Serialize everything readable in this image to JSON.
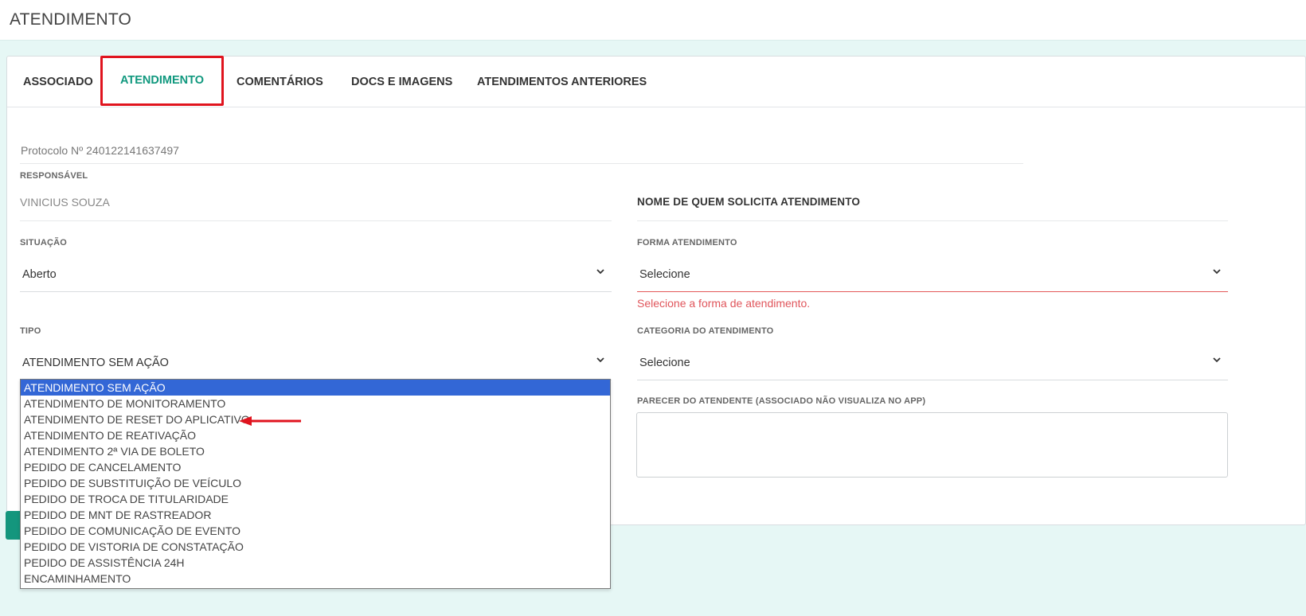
{
  "header": {
    "title": "ATENDIMENTO"
  },
  "tabs": [
    {
      "label": "ASSOCIADO"
    },
    {
      "label": "ATENDIMENTO"
    },
    {
      "label": "COMENTÁRIOS"
    },
    {
      "label": "DOCS E IMAGENS"
    },
    {
      "label": "ATENDIMENTOS ANTERIORES"
    }
  ],
  "active_tab": "ATENDIMENTO",
  "form": {
    "protocol": "Protocolo Nº 240122141637497",
    "responsavel_label": "RESPONSÁVEL",
    "responsavel_value": "VINICIUS SOUZA",
    "solicitante_label": "NOME DE QUEM SOLICITA ATENDIMENTO",
    "situacao_label": "SITUAÇÃO",
    "situacao_value": "Aberto",
    "forma_label": "FORMA ATENDIMENTO",
    "forma_value": "Selecione",
    "forma_error": "Selecione a forma de atendimento.",
    "tipo_label": "TIPO",
    "tipo_value": "ATENDIMENTO SEM AÇÃO",
    "categoria_label": "CATEGORIA DO ATENDIMENTO",
    "categoria_value": "Selecione",
    "parecer_label": "PARECER DO ATENDENTE (ASSOCIADO NÃO VISUALIZA NO APP)",
    "parecer_value": ""
  },
  "tipo_options": [
    "ATENDIMENTO SEM AÇÃO",
    "ATENDIMENTO DE MONITORAMENTO",
    "ATENDIMENTO DE RESET DO APLICATIVO",
    "ATENDIMENTO DE REATIVAÇÃO",
    "ATENDIMENTO 2ª VIA DE BOLETO",
    "PEDIDO DE CANCELAMENTO",
    "PEDIDO DE SUBSTITUIÇÃO DE VEÍCULO",
    "PEDIDO DE TROCA DE TITULARIDADE",
    "PEDIDO DE MNT DE RASTREADOR",
    "PEDIDO DE COMUNICAÇÃO DE EVENTO",
    "PEDIDO DE VISTORIA DE CONSTATAÇÃO",
    "PEDIDO DE ASSISTÊNCIA 24H",
    "ENCAMINHAMENTO"
  ],
  "selected_option": "ATENDIMENTO SEM AÇÃO",
  "colors": {
    "accent": "#10987e",
    "highlight_box": "#e0141e",
    "annotation_arrow": "#e0141e",
    "error": "#e0555b",
    "selected_option_bg": "#3367d6",
    "page_bg": "#e6f7f5"
  },
  "icons": {
    "select_caret": "chevron-down-icon",
    "annotation": "red-arrow-left-icon",
    "textarea_resize": "resize-grip-icon"
  }
}
